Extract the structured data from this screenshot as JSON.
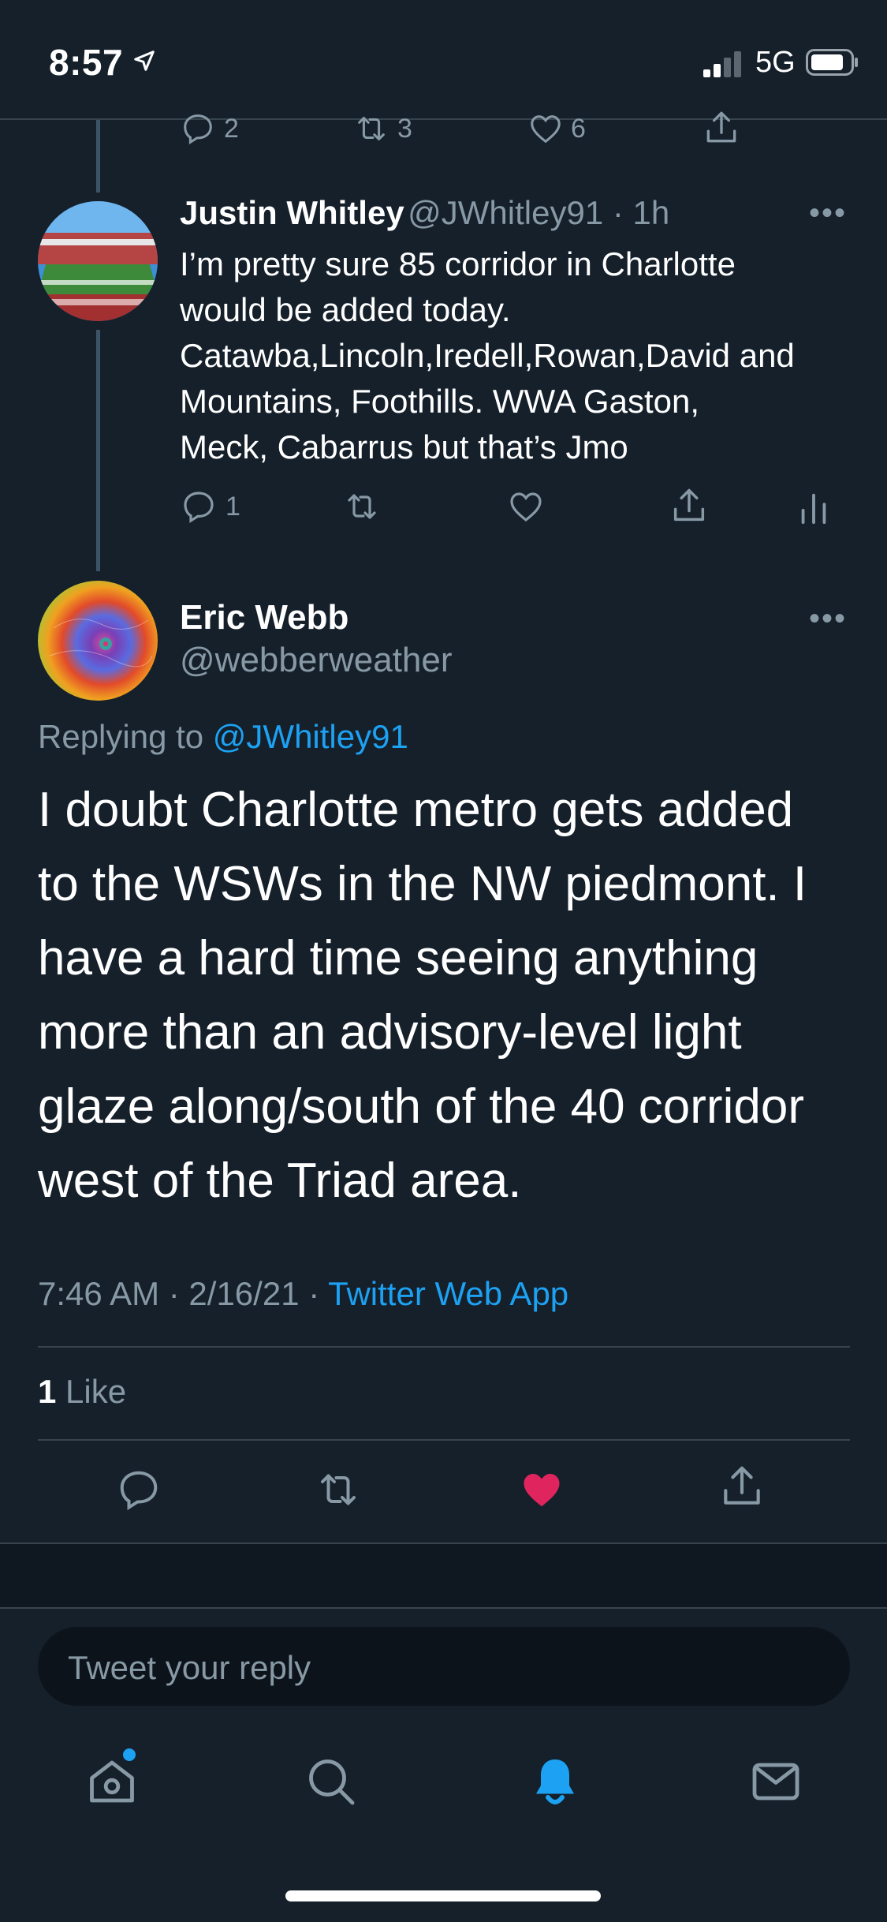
{
  "status_bar": {
    "time": "8:57",
    "network": "5G"
  },
  "prev_tweet_actions": {
    "replies": "2",
    "retweets": "3",
    "likes": "6"
  },
  "reply_tweet": {
    "author_name": "Justin Whitley",
    "handle_time": "@JWhitley91 · 1h",
    "lines": [
      "I’m pretty sure 85 corridor in Charlotte",
      "would be added today.",
      "Catawba,Lincoln,Iredell,Rowan,David and",
      "Mountains, Foothills. WWA Gaston,",
      "Meck, Cabarrus but that’s Jmo"
    ],
    "reply_count": "1"
  },
  "main_tweet": {
    "author_name": "Eric Webb",
    "handle": "@webberweather",
    "replying_prefix": "Replying to ",
    "replying_handle": "@JWhitley91",
    "lines": [
      "I doubt Charlotte metro gets added",
      "to the WSWs in the NW piedmont. I",
      "have a hard time seeing anything",
      "more than an advisory-level light",
      "glaze along/south of the 40 corridor",
      "west of the Triad area."
    ],
    "timestamp": "7:46 AM · 2/16/21 · ",
    "source": "Twitter Web App",
    "like_count": "1",
    "like_label": " Like"
  },
  "reply_input": {
    "placeholder": "Tweet your reply"
  },
  "tab_bar": {
    "items": [
      "home",
      "search",
      "notifications",
      "messages"
    ]
  },
  "colors": {
    "background": "#15202b",
    "accent": "#1da1f2",
    "like": "#e0245e",
    "muted": "#8899a6"
  }
}
